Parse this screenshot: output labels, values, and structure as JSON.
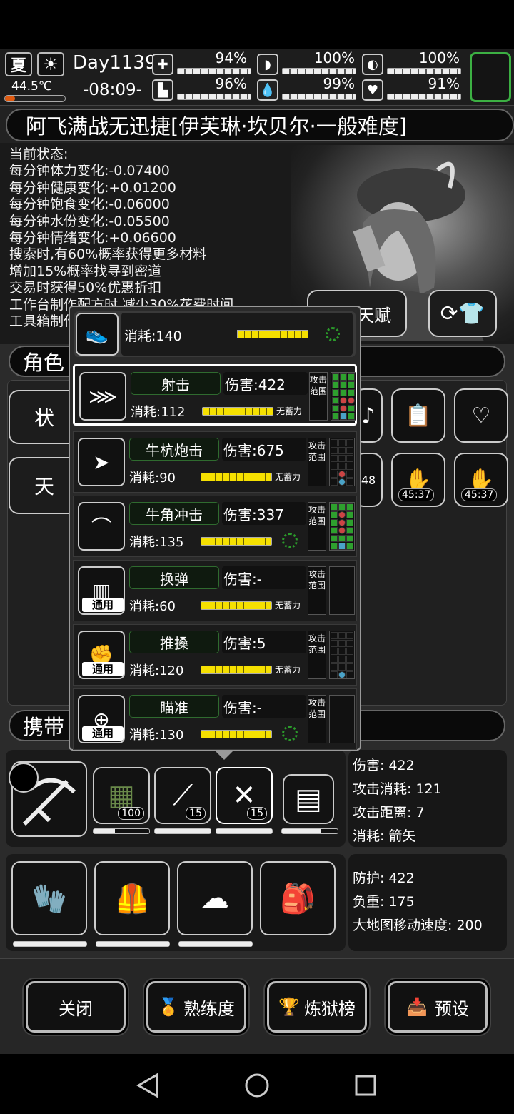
{
  "status": {
    "season": "夏",
    "temperature": "44.5℃",
    "day": "Day1139",
    "time": "-08:09-",
    "stats": [
      {
        "icon": "medkit-icon",
        "pct": "94%",
        "level": 0.94
      },
      {
        "icon": "stomach-icon",
        "pct": "100%",
        "level": 1.0
      },
      {
        "icon": "mood-icon",
        "pct": "100%",
        "level": 1.0
      },
      {
        "icon": "boot-icon",
        "pct": "96%",
        "level": 0.96
      },
      {
        "icon": "water-drop-icon",
        "pct": "99%",
        "level": 0.99
      },
      {
        "icon": "heart-icon",
        "pct": "91%",
        "level": 0.91
      }
    ]
  },
  "title": "阿飞满战无迅捷[伊芙琳·坎贝尔·一般难度]",
  "current_status": {
    "heading": "当前状态:",
    "lines": [
      "每分钟体力变化:-0.07400",
      "每分钟健康变化:+0.01200",
      "每分钟饱食变化:-0.06000",
      "每分钟水份变化:-0.05500",
      "每分钟情绪变化:+0.06600",
      "搜索时,有60%概率获得更多材料",
      "增加15%概率找寻到密道",
      "交易时获得50%优惠折扣",
      "工作台制作配方时,减少30%花费时间",
      "工具箱制作"
    ]
  },
  "talent_button": "调整天赋",
  "character_section": {
    "title": "角色",
    "tab_status": "状",
    "tab_talent": "天"
  },
  "timers": [
    "45:37",
    "45:37"
  ],
  "popup": {
    "move": {
      "cost": "消耗:140"
    },
    "skills": [
      {
        "name": "射击",
        "damage": "伤害:422",
        "cost": "消耗:112",
        "charge": "无蓄力",
        "range": "攻击范围",
        "general": ""
      },
      {
        "name": "牛杭炮击",
        "damage": "伤害:675",
        "cost": "消耗:90",
        "charge": "无蓄力",
        "range": "攻击范围",
        "general": ""
      },
      {
        "name": "牛角冲击",
        "damage": "伤害:337",
        "cost": "消耗:135",
        "charge": "",
        "range": "攻击范围",
        "general": ""
      },
      {
        "name": "换弹",
        "damage": "伤害:-",
        "cost": "消耗:60",
        "charge": "无蓄力",
        "range": "攻击范围",
        "general": "通用"
      },
      {
        "name": "推搡",
        "damage": "伤害:5",
        "cost": "消耗:120",
        "charge": "无蓄力",
        "range": "攻击范围",
        "general": "通用"
      },
      {
        "name": "瞄准",
        "damage": "伤害:-",
        "cost": "消耗:130",
        "charge": "",
        "range": "攻击范围",
        "general": "通用"
      }
    ]
  },
  "carry_section": {
    "title": "携带"
  },
  "weapon_slots": [
    {
      "icon": "ammo-belt-icon",
      "count": "100"
    },
    {
      "icon": "syringe-icon",
      "count": "15"
    },
    {
      "icon": "crossbow-icon",
      "count": "15"
    }
  ],
  "weapon_info": {
    "damage": "伤害: 422",
    "attack_cost": "攻击消耗: 121",
    "attack_range": "攻击距离: 7",
    "consume": "消耗: 箭矢"
  },
  "armor_info": {
    "defense": "防护: 422",
    "weight": "负重: 175",
    "map_speed": "大地图移动速度: 200"
  },
  "bottom_buttons": {
    "close": "关闭",
    "proficiency": "熟练度",
    "purgatory": "炼狱榜",
    "preset": "预设"
  }
}
